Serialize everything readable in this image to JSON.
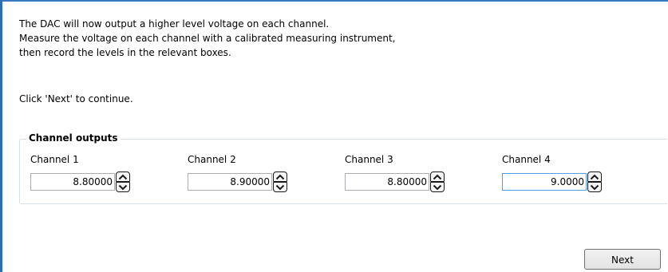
{
  "instructions": {
    "line1": "The DAC will now output a higher level voltage on each channel.",
    "line2": "Measure the voltage on each channel with a calibrated measuring instrument,",
    "line3": "then record the levels in the relevant boxes.",
    "continue": "Click 'Next' to continue."
  },
  "channel_outputs": {
    "title": "Channel outputs",
    "channels": [
      {
        "label": "Channel 1",
        "value": "8.80000"
      },
      {
        "label": "Channel 2",
        "value": "8.90000"
      },
      {
        "label": "Channel 3",
        "value": "8.80000"
      },
      {
        "label": "Channel 4",
        "value": "9.0000"
      }
    ]
  },
  "icons": {
    "spin_up": "chevron-up-icon",
    "spin_down": "chevron-down-icon"
  },
  "footer": {
    "next_label": "Next"
  },
  "colors": {
    "frame_accent": "#2e6db4",
    "group_border": "#d5dfe5",
    "focused_border": "#569de5"
  }
}
